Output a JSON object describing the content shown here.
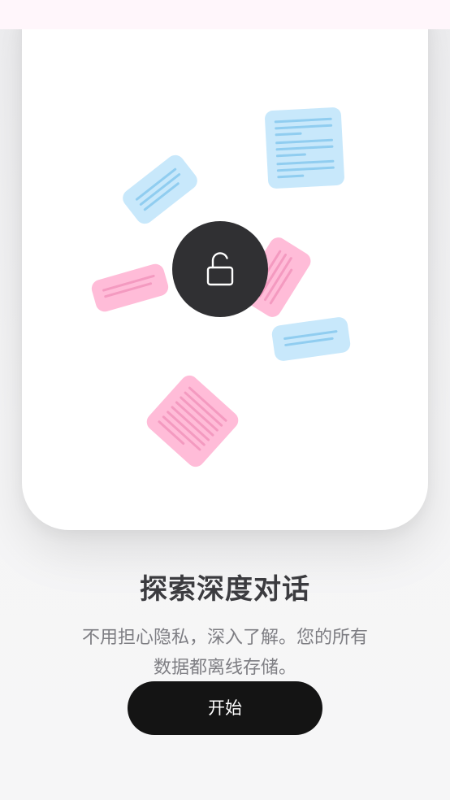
{
  "onboarding": {
    "title": "探索深度对话",
    "subtitle": "不用担心隐私，深入了解。您的所有数据都离线存储。",
    "start_label": "开始"
  },
  "colors": {
    "note_blue": "#c8e8fb",
    "note_blue_line": "#90cdf0",
    "note_pink": "#ffbcd8",
    "note_pink_line": "#f49ac0",
    "lock_circle": "#303033",
    "button": "#141414"
  },
  "icons": {
    "center": "unlock-icon"
  }
}
